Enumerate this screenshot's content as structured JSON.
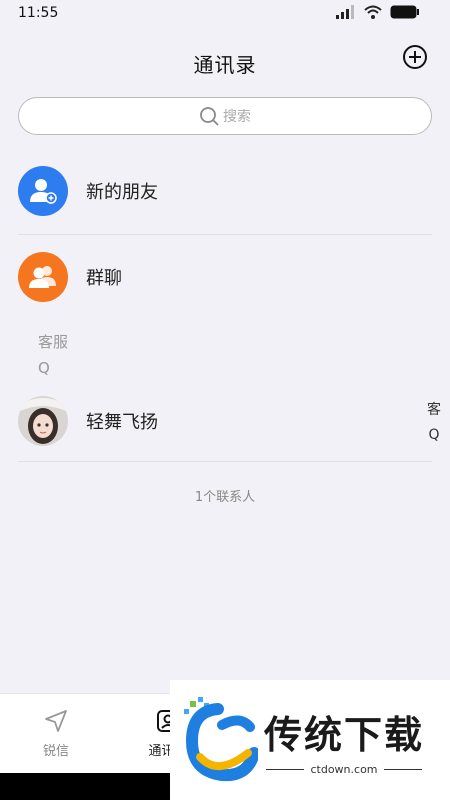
{
  "status_bar": {
    "time": "11:55"
  },
  "header": {
    "title": "通讯录"
  },
  "search": {
    "placeholder": "搜索"
  },
  "entries": [
    {
      "label": "新的朋友",
      "icon": "add-user-icon",
      "color": "#2d7cf0"
    },
    {
      "label": "群聊",
      "icon": "group-icon",
      "color": "#f5761e"
    }
  ],
  "group": {
    "title": "客服",
    "letter": "Q"
  },
  "contacts": [
    {
      "name": "轻舞飞扬"
    }
  ],
  "index_bar": [
    "客",
    "Q"
  ],
  "contact_count": "1个联系人",
  "tabs": [
    {
      "label": "锐信",
      "icon": "send-icon"
    },
    {
      "label": "通讯录",
      "icon": "contacts-icon"
    }
  ],
  "watermark": {
    "title": "传统下载",
    "url": "ctdown.com"
  }
}
